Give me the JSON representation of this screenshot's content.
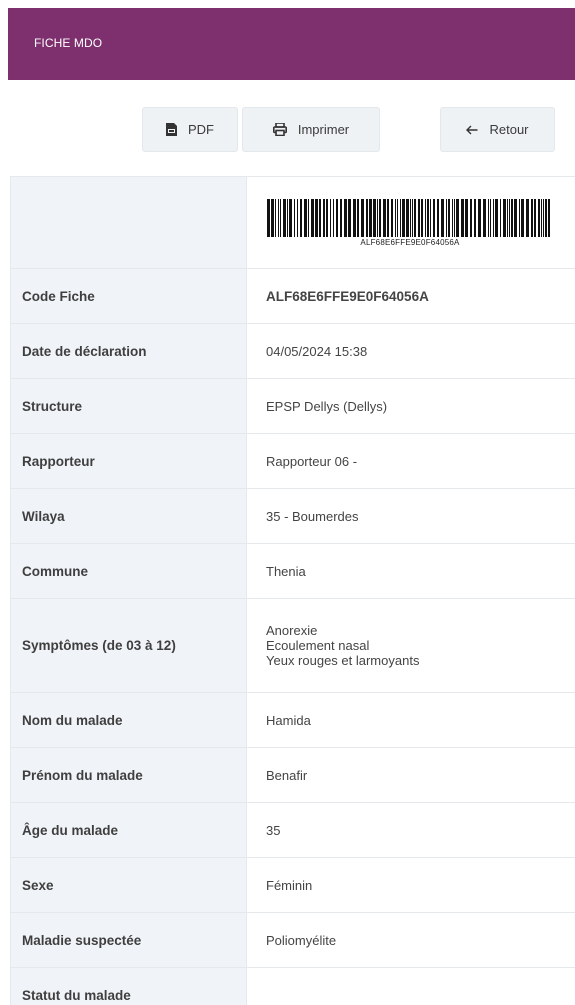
{
  "header": {
    "title": "FICHE MDO"
  },
  "toolbar": {
    "pdf_label": "PDF",
    "print_label": "Imprimer",
    "back_label": "Retour"
  },
  "barcode": {
    "text": "ALF68E6FFE9E0F64056A"
  },
  "rows": [
    {
      "label": "Code Fiche",
      "value": "ALF68E6FFE9E0F64056A"
    },
    {
      "label": "Date de déclaration",
      "value": "04/05/2024 15:38"
    },
    {
      "label": "Structure",
      "value": "EPSP Dellys (Dellys)"
    },
    {
      "label": "Rapporteur",
      "value": "Rapporteur 06 -"
    },
    {
      "label": "Wilaya",
      "value": "35 - Boumerdes"
    },
    {
      "label": "Commune",
      "value": "Thenia"
    },
    {
      "label": "Symptômes (de 03 à 12)",
      "values": [
        "Anorexie",
        "Ecoulement nasal",
        "Yeux rouges et larmoyants"
      ]
    },
    {
      "label": "Nom du malade",
      "value": "Hamida"
    },
    {
      "label": "Prénom du malade",
      "value": "Benafir"
    },
    {
      "label": "Âge du malade",
      "value": "35"
    },
    {
      "label": "Sexe",
      "value": "Féminin"
    },
    {
      "label": "Maladie suspectée",
      "value": "Poliomyélite"
    },
    {
      "label": "Statut du malade",
      "value": ""
    }
  ]
}
